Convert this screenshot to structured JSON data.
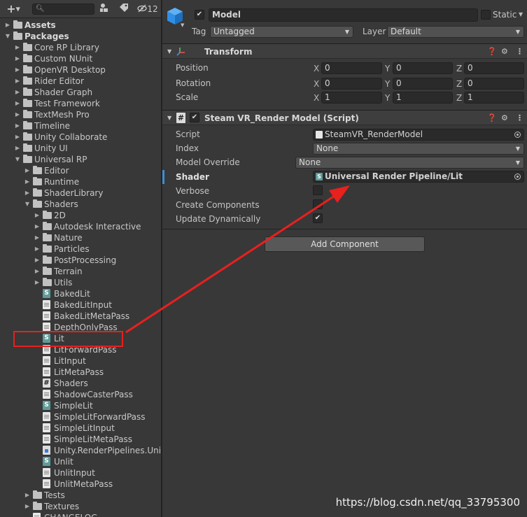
{
  "project_panel": {
    "toolbar": {
      "create_label": "+",
      "hidden_count": "12"
    },
    "tree": [
      {
        "label": "Assets",
        "kind": "folder",
        "depth": 0,
        "expanded": false,
        "bold": true
      },
      {
        "label": "Packages",
        "kind": "folder",
        "depth": 0,
        "expanded": true,
        "bold": true
      },
      {
        "label": "Core RP Library",
        "kind": "folder",
        "depth": 1,
        "expanded": false
      },
      {
        "label": "Custom NUnit",
        "kind": "folder",
        "depth": 1,
        "expanded": false
      },
      {
        "label": "OpenVR Desktop",
        "kind": "folder",
        "depth": 1,
        "expanded": false
      },
      {
        "label": "Rider Editor",
        "kind": "folder",
        "depth": 1,
        "expanded": false
      },
      {
        "label": "Shader Graph",
        "kind": "folder",
        "depth": 1,
        "expanded": false
      },
      {
        "label": "Test Framework",
        "kind": "folder",
        "depth": 1,
        "expanded": false
      },
      {
        "label": "TextMesh Pro",
        "kind": "folder",
        "depth": 1,
        "expanded": false
      },
      {
        "label": "Timeline",
        "kind": "folder",
        "depth": 1,
        "expanded": false
      },
      {
        "label": "Unity Collaborate",
        "kind": "folder",
        "depth": 1,
        "expanded": false
      },
      {
        "label": "Unity UI",
        "kind": "folder",
        "depth": 1,
        "expanded": false
      },
      {
        "label": "Universal RP",
        "kind": "folder",
        "depth": 1,
        "expanded": true
      },
      {
        "label": "Editor",
        "kind": "folder",
        "depth": 2,
        "expanded": false
      },
      {
        "label": "Runtime",
        "kind": "folder",
        "depth": 2,
        "expanded": false
      },
      {
        "label": "ShaderLibrary",
        "kind": "folder",
        "depth": 2,
        "expanded": false
      },
      {
        "label": "Shaders",
        "kind": "folder",
        "depth": 2,
        "expanded": true
      },
      {
        "label": "2D",
        "kind": "folder",
        "depth": 3,
        "expanded": false
      },
      {
        "label": "Autodesk Interactive",
        "kind": "folder",
        "depth": 3,
        "expanded": false
      },
      {
        "label": "Nature",
        "kind": "folder",
        "depth": 3,
        "expanded": false
      },
      {
        "label": "Particles",
        "kind": "folder",
        "depth": 3,
        "expanded": false
      },
      {
        "label": "PostProcessing",
        "kind": "folder",
        "depth": 3,
        "expanded": false
      },
      {
        "label": "Terrain",
        "kind": "folder",
        "depth": 3,
        "expanded": false
      },
      {
        "label": "Utils",
        "kind": "folder",
        "depth": 3,
        "expanded": false
      },
      {
        "label": "BakedLit",
        "kind": "shader",
        "depth": 3
      },
      {
        "label": "BakedLitInput",
        "kind": "file",
        "depth": 3
      },
      {
        "label": "BakedLitMetaPass",
        "kind": "file",
        "depth": 3
      },
      {
        "label": "DepthOnlyPass",
        "kind": "file",
        "depth": 3
      },
      {
        "label": "Lit",
        "kind": "shader",
        "depth": 3
      },
      {
        "label": "LitForwardPass",
        "kind": "file",
        "depth": 3
      },
      {
        "label": "LitInput",
        "kind": "file",
        "depth": 3
      },
      {
        "label": "LitMetaPass",
        "kind": "file",
        "depth": 3
      },
      {
        "label": "Shaders",
        "kind": "script",
        "depth": 3
      },
      {
        "label": "ShadowCasterPass",
        "kind": "file",
        "depth": 3
      },
      {
        "label": "SimpleLit",
        "kind": "shader",
        "depth": 3
      },
      {
        "label": "SimpleLitForwardPass",
        "kind": "file",
        "depth": 3
      },
      {
        "label": "SimpleLitInput",
        "kind": "file",
        "depth": 3
      },
      {
        "label": "SimpleLitMetaPass",
        "kind": "file",
        "depth": 3
      },
      {
        "label": "Unity.RenderPipelines.Univ",
        "kind": "asmdef",
        "depth": 3
      },
      {
        "label": "Unlit",
        "kind": "shader",
        "depth": 3
      },
      {
        "label": "UnlitInput",
        "kind": "file",
        "depth": 3
      },
      {
        "label": "UnlitMetaPass",
        "kind": "file",
        "depth": 3
      },
      {
        "label": "Tests",
        "kind": "folder",
        "depth": 2,
        "expanded": false
      },
      {
        "label": "Textures",
        "kind": "folder",
        "depth": 2,
        "expanded": false
      },
      {
        "label": "CHANGELOG",
        "kind": "file",
        "depth": 2
      }
    ]
  },
  "inspector": {
    "object": {
      "enabled": true,
      "name": "Model",
      "static_label": "Static",
      "tag_label": "Tag",
      "tag_value": "Untagged",
      "layer_label": "Layer",
      "layer_value": "Default"
    },
    "transform": {
      "title": "Transform",
      "rows": [
        {
          "label": "Position",
          "x": "0",
          "y": "0",
          "z": "0"
        },
        {
          "label": "Rotation",
          "x": "0",
          "y": "0",
          "z": "0"
        },
        {
          "label": "Scale",
          "x": "1",
          "y": "1",
          "z": "1"
        }
      ],
      "axis_x": "X",
      "axis_y": "Y",
      "axis_z": "Z"
    },
    "script_component": {
      "title": "Steam VR_Render Model (Script)",
      "enabled": true,
      "fields": {
        "script_label": "Script",
        "script_value": "SteamVR_RenderModel",
        "index_label": "Index",
        "index_value": "None",
        "model_override_label": "Model Override",
        "model_override_value": "None",
        "shader_label": "Shader",
        "shader_value": "Universal Render Pipeline/Lit",
        "verbose_label": "Verbose",
        "verbose_checked": false,
        "create_components_label": "Create Components",
        "create_components_checked": false,
        "update_dynamically_label": "Update Dynamically",
        "update_dynamically_checked": true
      }
    },
    "add_component_label": "Add Component"
  },
  "watermark": "https://blog.csdn.net/qq_33795300",
  "colors": {
    "panel_bg": "#383838",
    "field_bg": "#2a2a2a",
    "annotation_red": "#e8201e",
    "cube_blue": "#2f8fe6"
  }
}
